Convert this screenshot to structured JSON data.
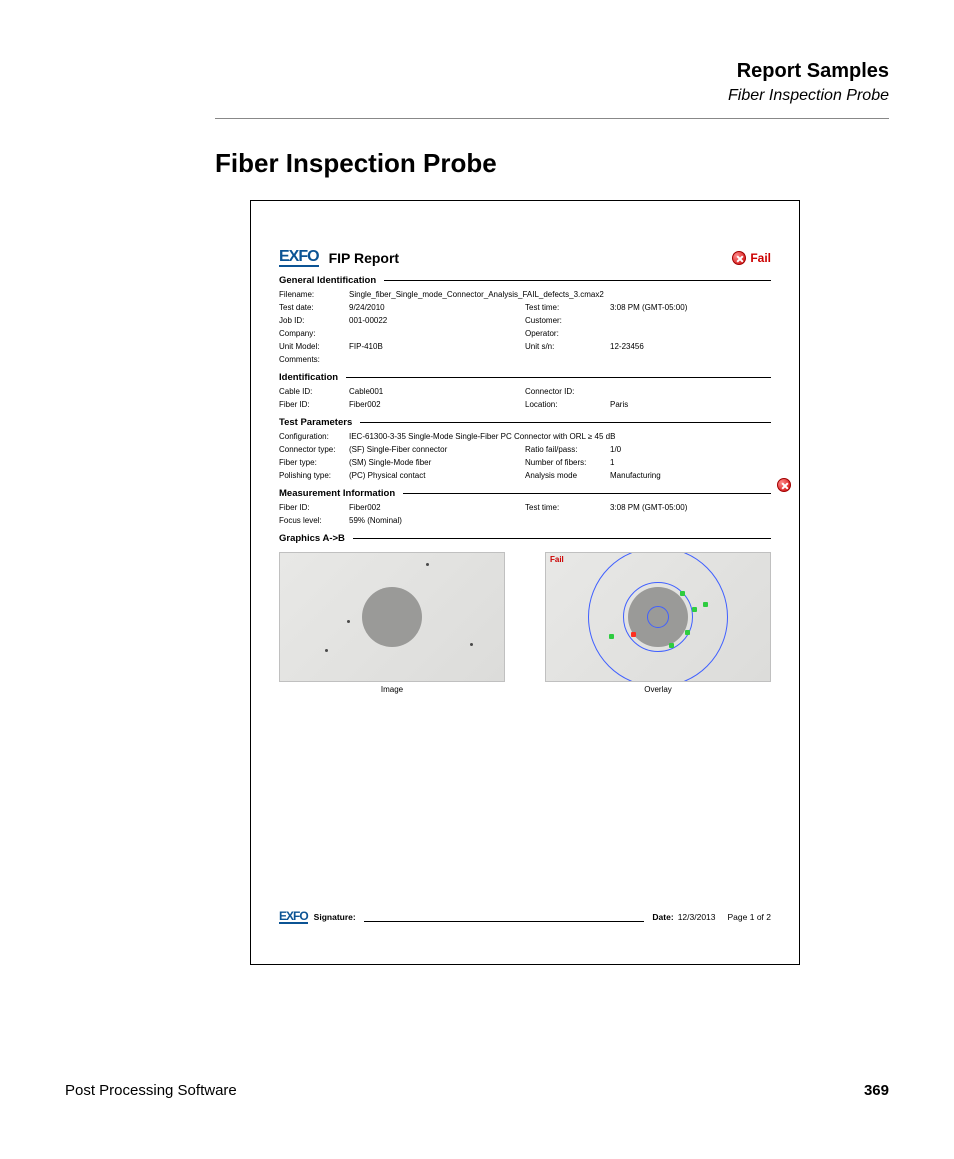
{
  "pageHeader": {
    "title": "Report Samples",
    "subtitle": "Fiber Inspection Probe"
  },
  "mainHeading": "Fiber Inspection Probe",
  "report": {
    "logoText": "EXFO",
    "title": "FIP Report",
    "failText": "Fail",
    "sections": {
      "generalIdent": "General Identification",
      "identification": "Identification",
      "testParams": "Test Parameters",
      "measInfo": "Measurement Information",
      "graphics": "Graphics   A->B"
    },
    "general": {
      "filenameLab": "Filename:",
      "filenameVal": "Single_fiber_Single_mode_Connector_Analysis_FAIL_defects_3.cmax2",
      "testDateLab": "Test date:",
      "testDateVal": "9/24/2010",
      "testTimeLab": "Test time:",
      "testTimeVal": "3:08 PM (GMT-05:00)",
      "jobIdLab": "Job ID:",
      "jobIdVal": "001-00022",
      "customerLab": "Customer:",
      "customerVal": "",
      "companyLab": "Company:",
      "companyVal": "",
      "operatorLab": "Operator:",
      "operatorVal": "",
      "unitModelLab": "Unit Model:",
      "unitModelVal": "FIP-410B",
      "unitSnLab": "Unit s/n:",
      "unitSnVal": "12-23456",
      "commentsLab": "Comments:",
      "commentsVal": ""
    },
    "ident": {
      "cableIdLab": "Cable ID:",
      "cableIdVal": "Cable001",
      "connIdLab": "Connector ID:",
      "connIdVal": "",
      "fiberIdLab": "Fiber ID:",
      "fiberIdVal": "Fiber002",
      "locationLab": "Location:",
      "locationVal": "Paris"
    },
    "params": {
      "configLab": "Configuration:",
      "configVal": "IEC-61300-3-35 Single-Mode Single-Fiber PC Connector with ORL ≥ 45 dB",
      "connTypeLab": "Connector type:",
      "connTypeVal": "(SF) Single-Fiber connector",
      "ratioLab": "Ratio fail/pass:",
      "ratioVal": "1/0",
      "fiberTypeLab": "Fiber type:",
      "fiberTypeVal": "(SM) Single-Mode fiber",
      "numFibLab": "Number of fibers:",
      "numFibVal": "1",
      "polishLab": "Polishing type:",
      "polishVal": "(PC) Physical contact",
      "analysisLab": "Analysis mode",
      "analysisVal": "Manufacturing"
    },
    "meas": {
      "fiberIdLab": "Fiber ID:",
      "fiberIdVal": "Fiber002",
      "testTimeLab": "Test time:",
      "testTimeVal": "3:08 PM (GMT-05:00)",
      "focusLab": "Focus level:",
      "focusVal": "59% (Nominal)"
    },
    "gfx": {
      "imageLabel": "Image",
      "overlayLabel": "Overlay",
      "overlayFail": "Fail"
    },
    "footer": {
      "sigLabel": "Signature:",
      "dateLabel": "Date:",
      "dateVal": "12/3/2013",
      "pageOf": "Page 1 of 2"
    }
  },
  "pageFooter": {
    "left": "Post Processing Software",
    "right": "369"
  }
}
